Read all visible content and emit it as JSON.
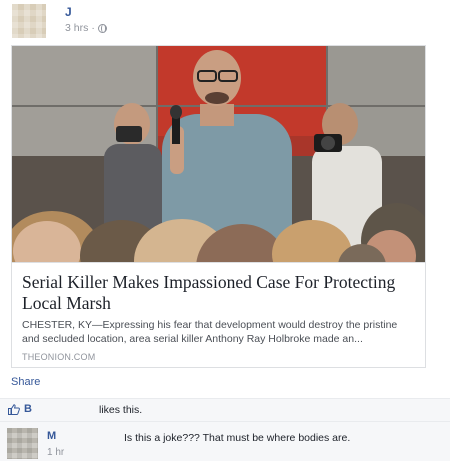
{
  "post": {
    "author": "J",
    "timestamp": "3 hrs",
    "separator": "·",
    "privacy_icon": "globe-icon"
  },
  "link_card": {
    "headline": "Serial Killer Makes Impassioned Case For Protecting Local Marsh",
    "summary": "CHESTER, KY—Expressing his fear that development would destroy the pristine and secluded location, area serial killer Anthony Ray Holbroke made an...",
    "domain": "THEONION.COM"
  },
  "actions": {
    "share_label": "Share"
  },
  "likes": {
    "icon": "thumbs-up-icon",
    "liker": "B",
    "text": "likes this."
  },
  "comment": {
    "author": "M",
    "time": "1 hr",
    "text": "Is this a joke??? That must be where bodies are."
  },
  "colors": {
    "link_blue": "#365899",
    "meta_gray": "#90949c",
    "panel_gray": "#f6f7f9",
    "border_gray": "#dddfe2"
  }
}
